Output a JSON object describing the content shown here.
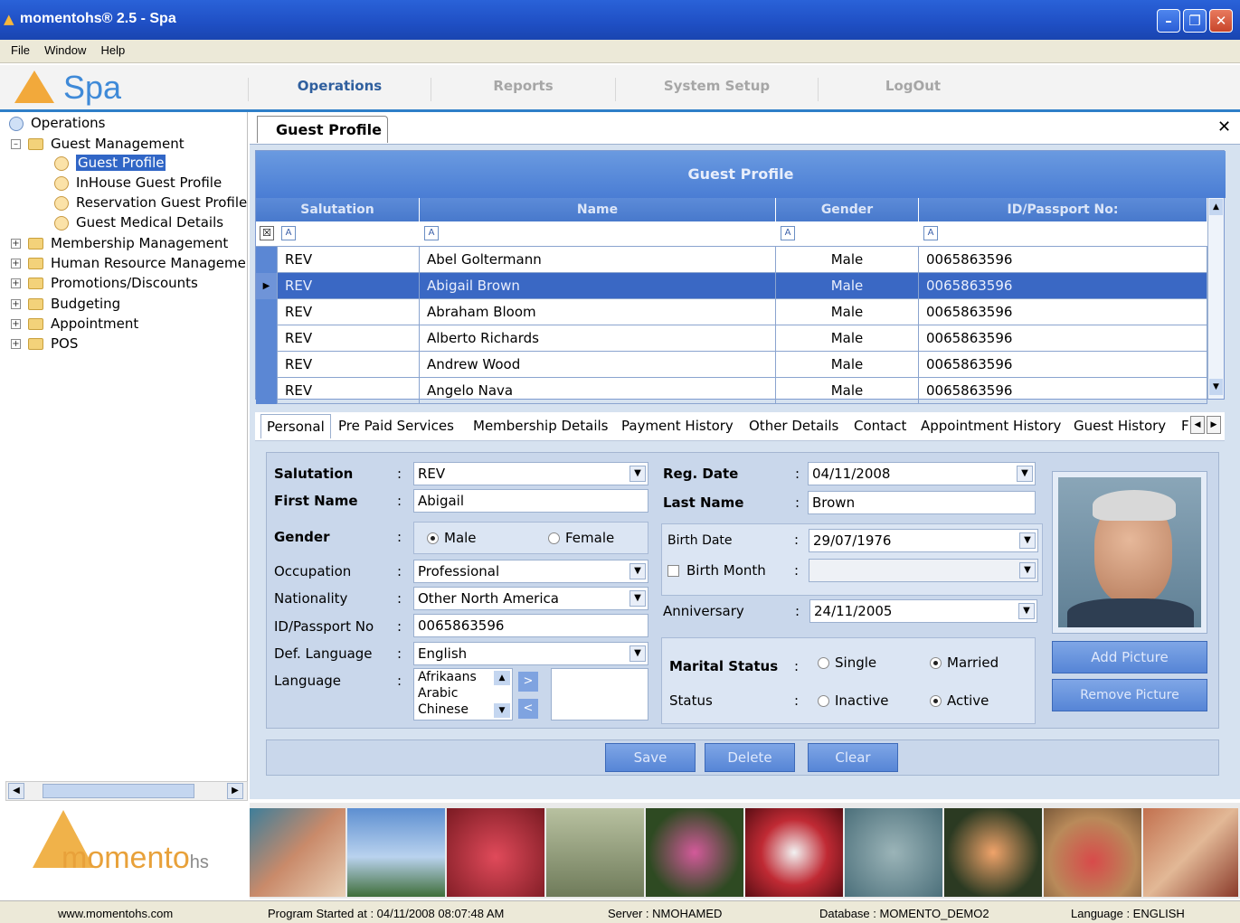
{
  "window": {
    "title": "momentohs® 2.5 - Spa"
  },
  "menu": [
    "File",
    "Window",
    "Help"
  ],
  "nav": {
    "logo": "Spa",
    "tabs": [
      "Operations",
      "Reports",
      "System Setup",
      "LogOut"
    ]
  },
  "tree": {
    "root": "Operations",
    "guest_mgmt": "Guest Management",
    "children": [
      "Guest Profile",
      "InHouse Guest Profile",
      "Reservation Guest Profile",
      "Guest Medical Details"
    ],
    "groups": [
      "Membership Management",
      "Human Resource Manageme",
      "Promotions/Discounts",
      "Budgeting",
      "Appointment",
      "POS"
    ]
  },
  "doc_tab": "Guest Profile",
  "grid": {
    "title": "Guest Profile",
    "columns": [
      "Salutation",
      "Name",
      "Gender",
      "ID/Passport No:"
    ],
    "rows": [
      [
        "REV",
        "Abel Goltermann",
        "Male",
        "0065863596"
      ],
      [
        "REV",
        "Abigail Brown",
        "Male",
        "0065863596"
      ],
      [
        "REV",
        "Abraham Bloom",
        "Male",
        "0065863596"
      ],
      [
        "REV",
        "Alberto Richards",
        "Male",
        "0065863596"
      ],
      [
        "REV",
        "Andrew Wood",
        "Male",
        "0065863596"
      ],
      [
        "REV",
        "Angelo Nava",
        "Male",
        "0065863596"
      ]
    ]
  },
  "subtabs": [
    "Personal",
    "Pre Paid Services",
    "Membership Details",
    "Payment History",
    "Other Details",
    "Contact",
    "Appointment History",
    "Guest History",
    "F"
  ],
  "form": {
    "salutation_lbl": "Salutation",
    "salutation": "REV",
    "first_name_lbl": "First Name",
    "first_name": "Abigail",
    "gender_lbl": "Gender",
    "male": "Male",
    "female": "Female",
    "occupation_lbl": "Occupation",
    "occupation": "Professional",
    "nationality_lbl": "Nationality",
    "nationality": "Other North America",
    "idpass_lbl": "ID/Passport No",
    "idpass": "0065863596",
    "deflang_lbl": "Def. Language",
    "deflang": "English",
    "language_lbl": "Language",
    "languages": [
      "Afrikaans",
      "Arabic",
      "Chinese"
    ],
    "regdate_lbl": "Reg. Date",
    "regdate": "04/11/2008",
    "lastname_lbl": "Last Name",
    "lastname": "Brown",
    "birthdate_lbl": "Birth Date",
    "birthdate": "29/07/1976",
    "birthmonth_lbl": "Birth Month",
    "anniv_lbl": "Anniversary",
    "anniv": "24/11/2005",
    "marital_lbl": "Marital Status",
    "single": "Single",
    "married": "Married",
    "status_lbl": "Status",
    "inactive": "Inactive",
    "active": "Active",
    "add_picture": "Add Picture",
    "remove_picture": "Remove Picture",
    "colon": ":"
  },
  "actions": {
    "save": "Save",
    "delete": "Delete",
    "clear": "Clear"
  },
  "logo_text": "momento",
  "logo_suffix": "hs",
  "status": {
    "web": "www.momentohs.com",
    "started": "Program Started at : 04/11/2008 08:07:48 AM",
    "server": "Server : NMOHAMED",
    "db": "Database : MOMENTO_DEMO2",
    "lang": "Language : ENGLISH"
  }
}
